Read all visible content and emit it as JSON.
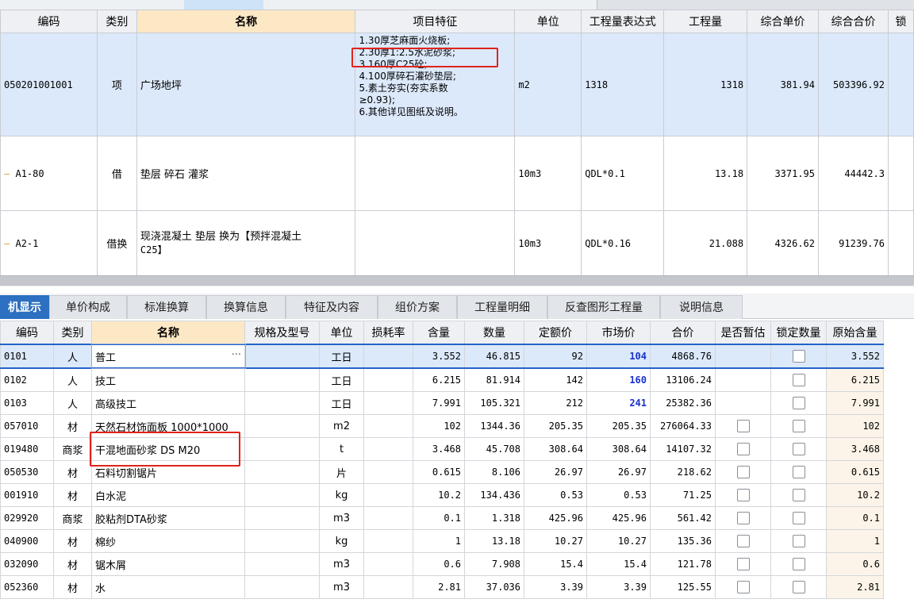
{
  "upper_table": {
    "columns": [
      "编码",
      "类别",
      "名称",
      "项目特征",
      "单位",
      "工程量表达式",
      "工程量",
      "综合单价",
      "综合合价",
      "锁"
    ],
    "rows": [
      {
        "code": "050201001001",
        "type": "项",
        "name": "广场地坪",
        "features": [
          "1.30厚芝麻面火烧板;",
          "2.30厚1:2.5水泥砂浆;",
          "3.160厚C25砼;",
          "4.100厚碎石灌砂垫层;",
          "5.素土夯实(夯实系数",
          "≥0.93);",
          "6.其他详见图纸及说明。"
        ],
        "unit": "m2",
        "expr": "1318",
        "qty": "1318",
        "unit_price": "381.94",
        "total": "503396.92"
      },
      {
        "code": "A1-80",
        "type": "借",
        "name": "垫层 碎石 灌浆",
        "features": [],
        "unit": "10m3",
        "expr": "QDL*0.1",
        "qty": "13.18",
        "unit_price": "3371.95",
        "total": "44442.3"
      },
      {
        "code": "A2-1",
        "type": "借换",
        "name_line1": "现浇混凝土 垫层  换为【预拌混凝土",
        "name_line2": "C25】",
        "features": [],
        "unit": "10m3",
        "expr": "QDL*0.16",
        "qty": "21.088",
        "unit_price": "4326.62",
        "total": "91239.76"
      }
    ]
  },
  "tabs": [
    "机显示",
    "单价构成",
    "标准换算",
    "换算信息",
    "特征及内容",
    "组价方案",
    "工程量明细",
    "反查图形工程量",
    "说明信息"
  ],
  "lower_table": {
    "columns": [
      "编码",
      "类别",
      "名称",
      "规格及型号",
      "单位",
      "损耗率",
      "含量",
      "数量",
      "定额价",
      "市场价",
      "合价",
      "是否暂估",
      "锁定数量",
      "原始含量"
    ],
    "rows": [
      {
        "code": "0101",
        "type": "人",
        "name": "普工",
        "spec": "",
        "unit": "工日",
        "loss": "",
        "content": "3.552",
        "qty": "46.815",
        "quota": "92",
        "market": "104",
        "total": "4868.76",
        "est": false,
        "lock": true,
        "orig": "3.552",
        "market_blue": true
      },
      {
        "code": "0102",
        "type": "人",
        "name": "技工",
        "spec": "",
        "unit": "工日",
        "loss": "",
        "content": "6.215",
        "qty": "81.914",
        "quota": "142",
        "market": "160",
        "total": "13106.24",
        "est": false,
        "lock": true,
        "orig": "6.215",
        "market_blue": true
      },
      {
        "code": "0103",
        "type": "人",
        "name": "高级技工",
        "spec": "",
        "unit": "工日",
        "loss": "",
        "content": "7.991",
        "qty": "105.321",
        "quota": "212",
        "market": "241",
        "total": "25382.36",
        "est": false,
        "lock": true,
        "orig": "7.991",
        "market_blue": true
      },
      {
        "code": "057010",
        "type": "材",
        "name": "天然石材饰面板 1000*1000",
        "spec": "",
        "unit": "m2",
        "loss": "",
        "content": "102",
        "qty": "1344.36",
        "quota": "205.35",
        "market": "205.35",
        "total": "276064.33",
        "est": true,
        "lock": true,
        "orig": "102",
        "market_blue": false
      },
      {
        "code": "019480",
        "type": "商浆",
        "name": "干混地面砂浆 DS M20",
        "spec": "",
        "unit": "t",
        "loss": "",
        "content": "3.468",
        "qty": "45.708",
        "quota": "308.64",
        "market": "308.64",
        "total": "14107.32",
        "est": true,
        "lock": true,
        "orig": "3.468",
        "market_blue": false
      },
      {
        "code": "050530",
        "type": "材",
        "name": "石料切割锯片",
        "spec": "",
        "unit": "片",
        "loss": "",
        "content": "0.615",
        "qty": "8.106",
        "quota": "26.97",
        "market": "26.97",
        "total": "218.62",
        "est": true,
        "lock": true,
        "orig": "0.615",
        "market_blue": false
      },
      {
        "code": "001910",
        "type": "材",
        "name": "白水泥",
        "spec": "",
        "unit": "kg",
        "loss": "",
        "content": "10.2",
        "qty": "134.436",
        "quota": "0.53",
        "market": "0.53",
        "total": "71.25",
        "est": true,
        "lock": true,
        "orig": "10.2",
        "market_blue": false
      },
      {
        "code": "029920",
        "type": "商浆",
        "name": "胶粘剂DTA砂浆",
        "spec": "",
        "unit": "m3",
        "loss": "",
        "content": "0.1",
        "qty": "1.318",
        "quota": "425.96",
        "market": "425.96",
        "total": "561.42",
        "est": true,
        "lock": true,
        "orig": "0.1",
        "market_blue": false
      },
      {
        "code": "040900",
        "type": "材",
        "name": "棉纱",
        "spec": "",
        "unit": "kg",
        "loss": "",
        "content": "1",
        "qty": "13.18",
        "quota": "10.27",
        "market": "10.27",
        "total": "135.36",
        "est": true,
        "lock": true,
        "orig": "1",
        "market_blue": false
      },
      {
        "code": "032090",
        "type": "材",
        "name": "锯木屑",
        "spec": "",
        "unit": "m3",
        "loss": "",
        "content": "0.6",
        "qty": "7.908",
        "quota": "15.4",
        "market": "15.4",
        "total": "121.78",
        "est": true,
        "lock": true,
        "orig": "0.6",
        "market_blue": false
      },
      {
        "code": "052360",
        "type": "材",
        "name": "水",
        "spec": "",
        "unit": "m3",
        "loss": "",
        "content": "2.81",
        "qty": "37.036",
        "quota": "3.39",
        "market": "3.39",
        "total": "125.55",
        "est": true,
        "lock": true,
        "orig": "2.81",
        "market_blue": false
      }
    ]
  },
  "colors": {
    "accent": "#2d6fc0",
    "header_highlight": "#fde8c5",
    "selected_row": "#dce9fb",
    "annotation_red": "#e0231b",
    "market_blue": "#1a33cc"
  }
}
